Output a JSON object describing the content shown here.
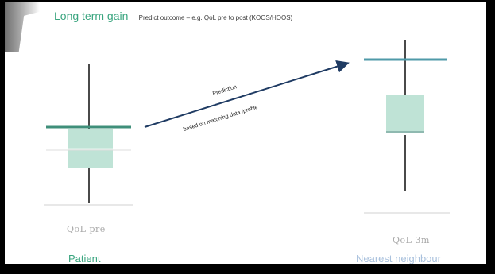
{
  "title": {
    "main": "Long term gain",
    "dash": "–",
    "subtitle": "Predict outcome – e.g. QoL pre to post (KOOS/HOOS)"
  },
  "arrow": {
    "label_top": "Prediction",
    "label_bottom": "based on matching data /profile"
  },
  "left_plot": {
    "axis_label": "QoL pre",
    "caption": "Patient"
  },
  "right_plot": {
    "axis_label": "QoL 3m",
    "caption": "Nearest neighbour"
  },
  "colors": {
    "title_green": "#3aa57f",
    "box_teal": "#bfe3d6",
    "highlight_line": "#3f8f7a",
    "arrow_navy": "#1f3b63",
    "caption_blue": "#a9c1dd"
  }
}
